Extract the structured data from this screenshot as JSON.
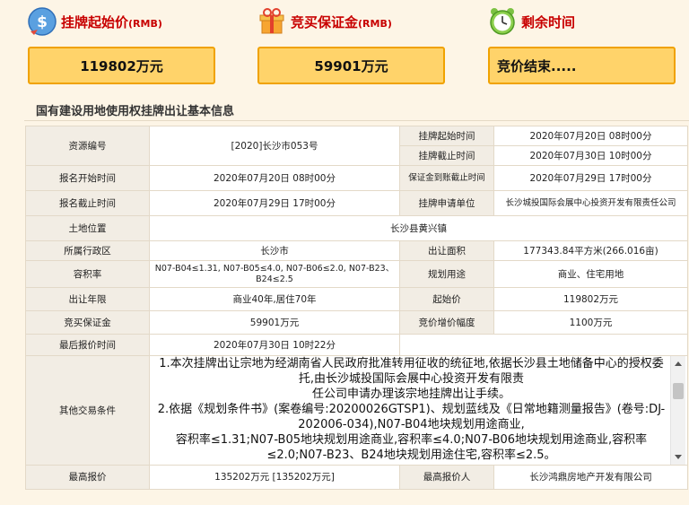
{
  "header": {
    "start_price": {
      "label": "挂牌起始价",
      "unit": "(RMB)",
      "value": "119802万元"
    },
    "deposit": {
      "label": "竞买保证金",
      "unit": "(RMB)",
      "value": "59901万元"
    },
    "remaining": {
      "label": "剩余时间",
      "value": "竞价结束....."
    }
  },
  "section_title": "国有建设用地使用权挂牌出让基本信息",
  "info": {
    "resource_no": {
      "label": "资源编号",
      "value": "[2020]长沙市053号"
    },
    "listing_start": {
      "label": "挂牌起始时间",
      "value": "2020年07月20日 08时00分"
    },
    "listing_end": {
      "label": "挂牌截止时间",
      "value": "2020年07月30日 10时00分"
    },
    "reg_start": {
      "label": "报名开始时间",
      "value": "2020年07月20日 08时00分"
    },
    "deposit_deadline": {
      "label": "保证金到账截止时间",
      "value": "2020年07月29日 17时00分"
    },
    "reg_end": {
      "label": "报名截止时间",
      "value": "2020年07月29日 17时00分"
    },
    "applicant": {
      "label": "挂牌申请单位",
      "value": "长沙城投国际会展中心投资开发有限责任公司"
    },
    "location": {
      "label": "土地位置",
      "value": "长沙县黄兴镇"
    },
    "district": {
      "label": "所属行政区",
      "value": "长沙市"
    },
    "area": {
      "label": "出让面积",
      "value": "177343.84平方米(266.016亩)"
    },
    "far": {
      "label": "容积率",
      "value": "N07-B04≤1.31, N07-B05≤4.0, N07-B06≤2.0, N07-B23、B24≤2.5"
    },
    "use": {
      "label": "规划用途",
      "value": "商业、住宅用地"
    },
    "term": {
      "label": "出让年限",
      "value": "商业40年,居住70年"
    },
    "start_price": {
      "label": "起始价",
      "value": "119802万元"
    },
    "deposit": {
      "label": "竞买保证金",
      "value": "59901万元"
    },
    "increment": {
      "label": "竞价增价幅度",
      "value": "1100万元"
    },
    "last_bid_time": {
      "label": "最后报价时间",
      "value": "2020年07月30日 10时22分"
    },
    "terms": {
      "label": "其他交易条件",
      "lines": [
        "1.本次挂牌出让宗地为经湖南省人民政府批准转用征收的统征地,依据长沙县土地储备中心的授权委托,由长沙城投国际会展中心投资开发有限责",
        "任公司申请办理该宗地挂牌出让手续。",
        "2.依据《规划条件书》(案卷编号:20200026GTSP1)、规划蓝线及《日常地籍测量报告》(卷号:DJ-202006-034),N07-B04地块规划用途商业,",
        "容积率≤1.31;N07-B05地块规划用途商业,容积率≤4.0;N07-B06地块规划用途商业,容积率≤2.0;N07-B23、B24地块规划用途住宅,容积率≤2.5。"
      ]
    },
    "highest_bid": {
      "label": "最高报价",
      "value": "135202万元 [135202万元]"
    },
    "highest_bidder": {
      "label": "最高报价人",
      "value": "长沙鸿鼎房地产开发有限公司"
    }
  },
  "colors": {
    "accent_red": "#c80000",
    "box_fill": "#ffd36a",
    "box_border": "#f0a200"
  },
  "icons": [
    "price-tag-icon",
    "gift-icon",
    "clock-icon",
    "scroll-up-arrow-icon",
    "scroll-down-arrow-icon"
  ]
}
